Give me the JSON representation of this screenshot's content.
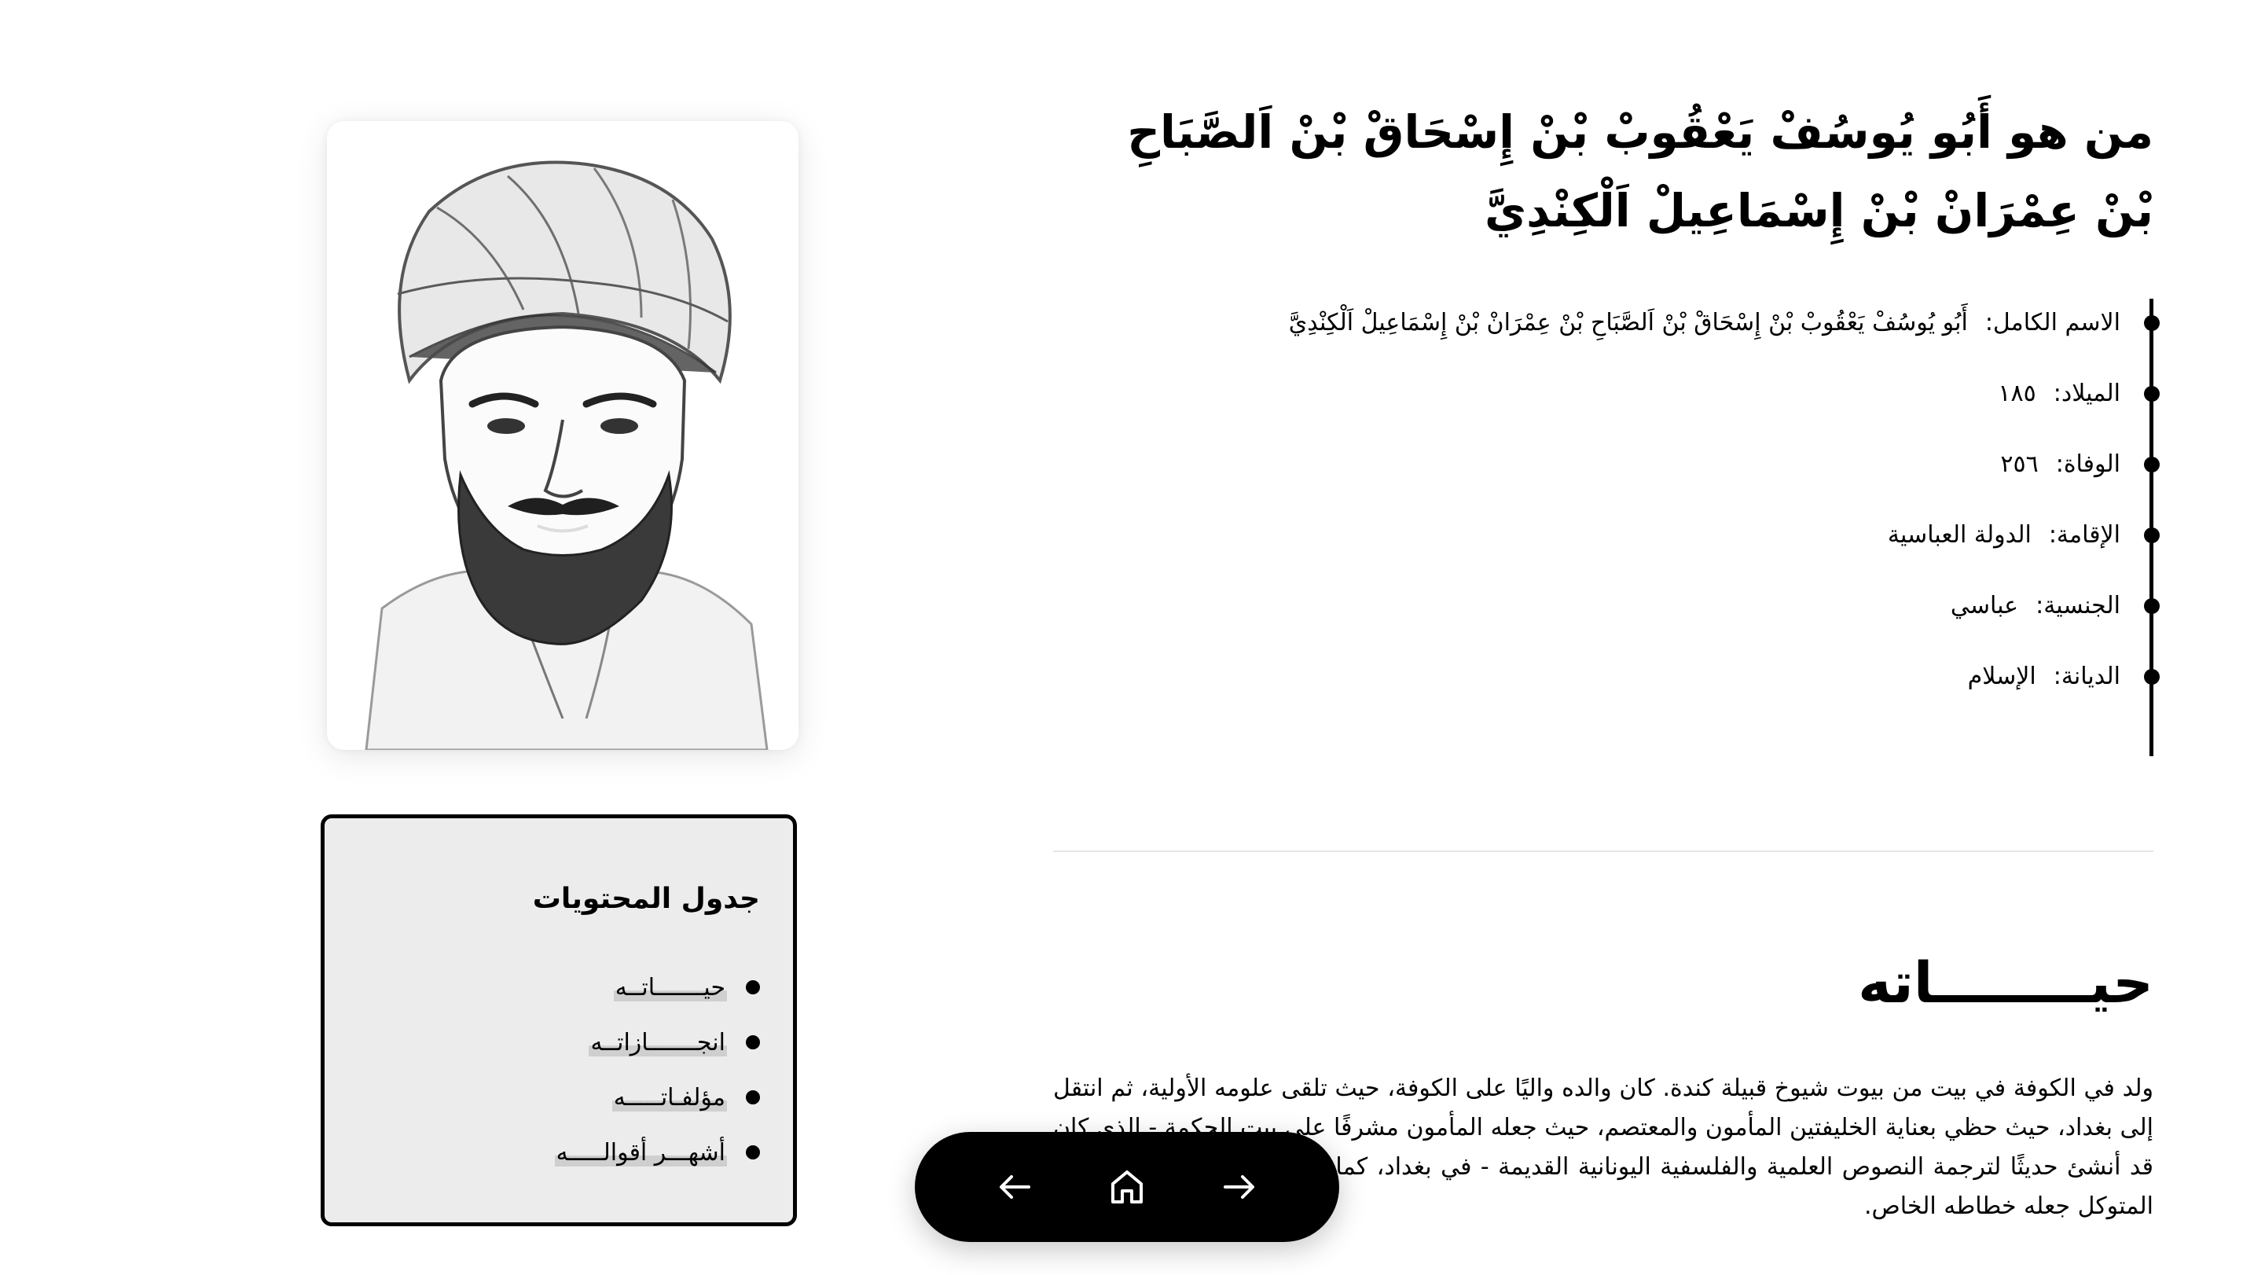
{
  "header": {
    "title": "من هو أَبُو يُوسُفْ يَعْقُوبْ بْنْ إِسْحَاقْ بْنْ اَلصَّبَاحِ بْنْ عِمْرَانْ بْنْ إِسْمَاعِيلْ اَلْكِنْدِيَّ"
  },
  "info": {
    "rows": [
      {
        "label": "الاسم الكامل:",
        "value": "أَبُو يُوسُفْ يَعْقُوبْ بْنْ إِسْحَاقْ بْنْ اَلصَّبَاحِ بْنْ عِمْرَانْ بْنْ إِسْمَاعِيلْ اَلْكِنْدِيَّ"
      },
      {
        "label": "الميلاد:",
        "value": "١٨٥"
      },
      {
        "label": "الوفاة:",
        "value": "٢٥٦"
      },
      {
        "label": "الإقامة:",
        "value": "الدولة العباسية"
      },
      {
        "label": "الجنسية:",
        "value": "عباسي"
      },
      {
        "label": "الديانة:",
        "value": "الإسلام"
      }
    ]
  },
  "section": {
    "title": "حيــــــــاته",
    "body": "ولد في الكوفة في بيت من بيوت شيوخ قبيلة كندة. كان والده واليًا على الكوفة، حيث تلقى علومه الأولية، ثم انتقل إلى بغداد، حيث حظي بعناية الخليفتين المأمون والمعتصم، حيث جعله المأمون مشرفًا على بيت الحكمة - الذي كان قد أنشئ حديثًا لترجمة النصوص العلمية والفلسفية اليونانية القديمة - في بغداد، كما اشتهر بحسن خطه، حتى أن المتوكل جعله خطاطه الخاص."
  },
  "portrait": {
    "icon": "portrait-sketch-icon"
  },
  "toc": {
    "title": "جدول المحتويات",
    "items": [
      {
        "label": "حيـــــــاتــه"
      },
      {
        "label": "انجـــــــازاتــه"
      },
      {
        "label": "مؤلفـاتـــــه"
      },
      {
        "label": "أشهـــر أقوالـــــه"
      }
    ]
  },
  "navbar": {
    "prev_icon": "arrow-left-icon",
    "home_icon": "home-icon",
    "next_icon": "arrow-right-icon"
  },
  "colors": {
    "background": "#ffffff",
    "text": "#000000",
    "toc_background": "#ececec",
    "link_highlight": "#cfcfcf",
    "navbar": "#000000"
  }
}
